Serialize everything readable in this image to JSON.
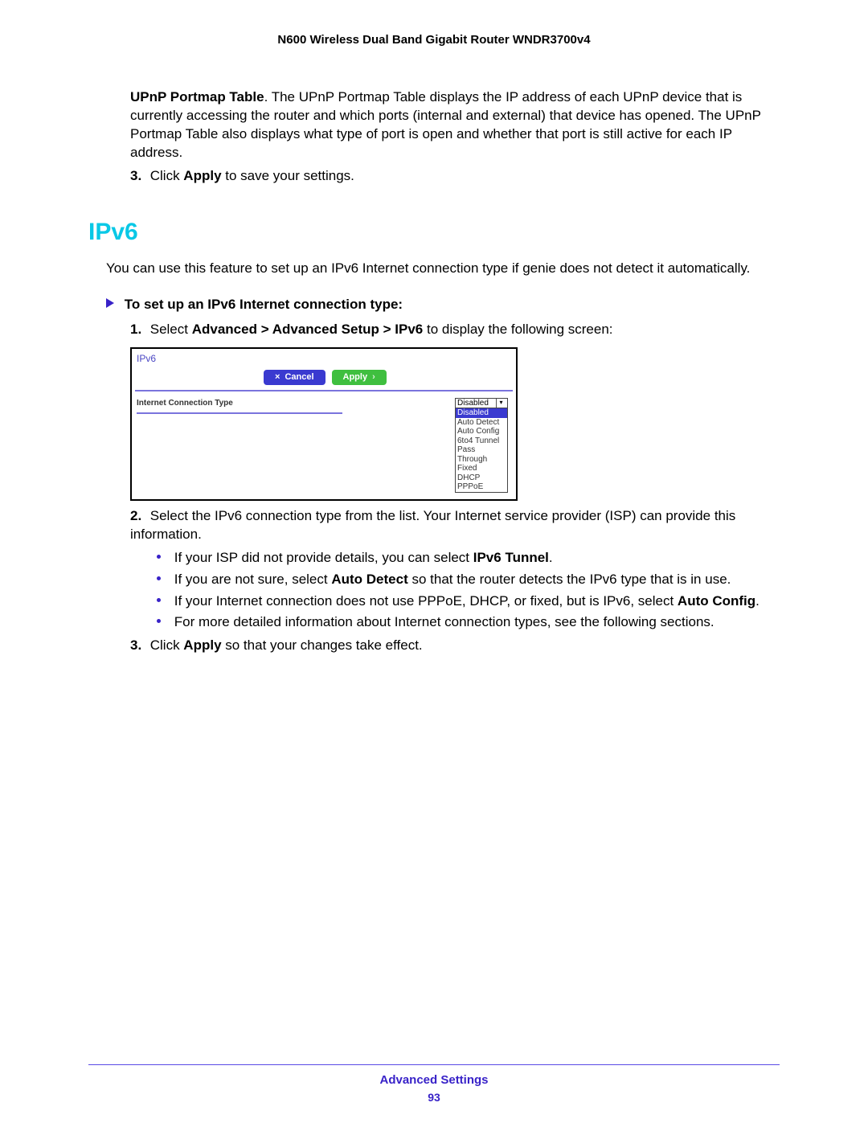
{
  "header": "N600 Wireless Dual Band Gigabit Router WNDR3700v4",
  "para_upnp": {
    "bold": "UPnP Portmap Table",
    "rest": ". The UPnP Portmap Table displays the IP address of each UPnP device that is currently accessing the router and which ports (internal and external) that device has opened. The UPnP Portmap Table also displays what type of port is open and whether that port is still active for each IP address."
  },
  "step_apply_1": {
    "num": "3.",
    "pre": "Click ",
    "bold": "Apply",
    "post": " to save your settings."
  },
  "section_title": "IPv6",
  "intro": "You can use this feature to set up an IPv6 Internet connection type if genie does not detect it automatically.",
  "task_title": "To set up an IPv6 Internet connection type:",
  "step1": {
    "num": "1.",
    "pre": "Select ",
    "bold": "Advanced > Advanced Setup > IPv6",
    "post": " to display the following screen:"
  },
  "ui": {
    "title": "IPv6",
    "cancel": "Cancel",
    "apply": "Apply",
    "label": "Internet Connection Type",
    "selected": "Disabled",
    "options": [
      "Disabled",
      "Auto Detect",
      "Auto Config",
      "6to4 Tunnel",
      "Pass Through",
      "Fixed",
      "DHCP",
      "PPPoE"
    ]
  },
  "step2": {
    "num": "2.",
    "text": "Select the IPv6 connection type from the list. Your Internet service provider (ISP) can provide this information."
  },
  "bullets": {
    "b1": {
      "pre": "If your ISP did not provide details, you can select ",
      "bold": "IPv6 Tunnel",
      "post": "."
    },
    "b2": {
      "pre": "If you are not sure, select ",
      "bold": "Auto Detect",
      "post": " so that the router detects the IPv6 type that is in use."
    },
    "b3": {
      "pre": "If your Internet connection does not use PPPoE, DHCP, or fixed, but is IPv6, select ",
      "bold": "Auto Config",
      "post": "."
    },
    "b4": {
      "text": "For more detailed information about Internet connection types, see the following sections."
    }
  },
  "step_apply_2": {
    "num": "3.",
    "pre": "Click ",
    "bold": "Apply",
    "post": " so that your changes take effect."
  },
  "footer": {
    "section": "Advanced Settings",
    "page": "93"
  }
}
